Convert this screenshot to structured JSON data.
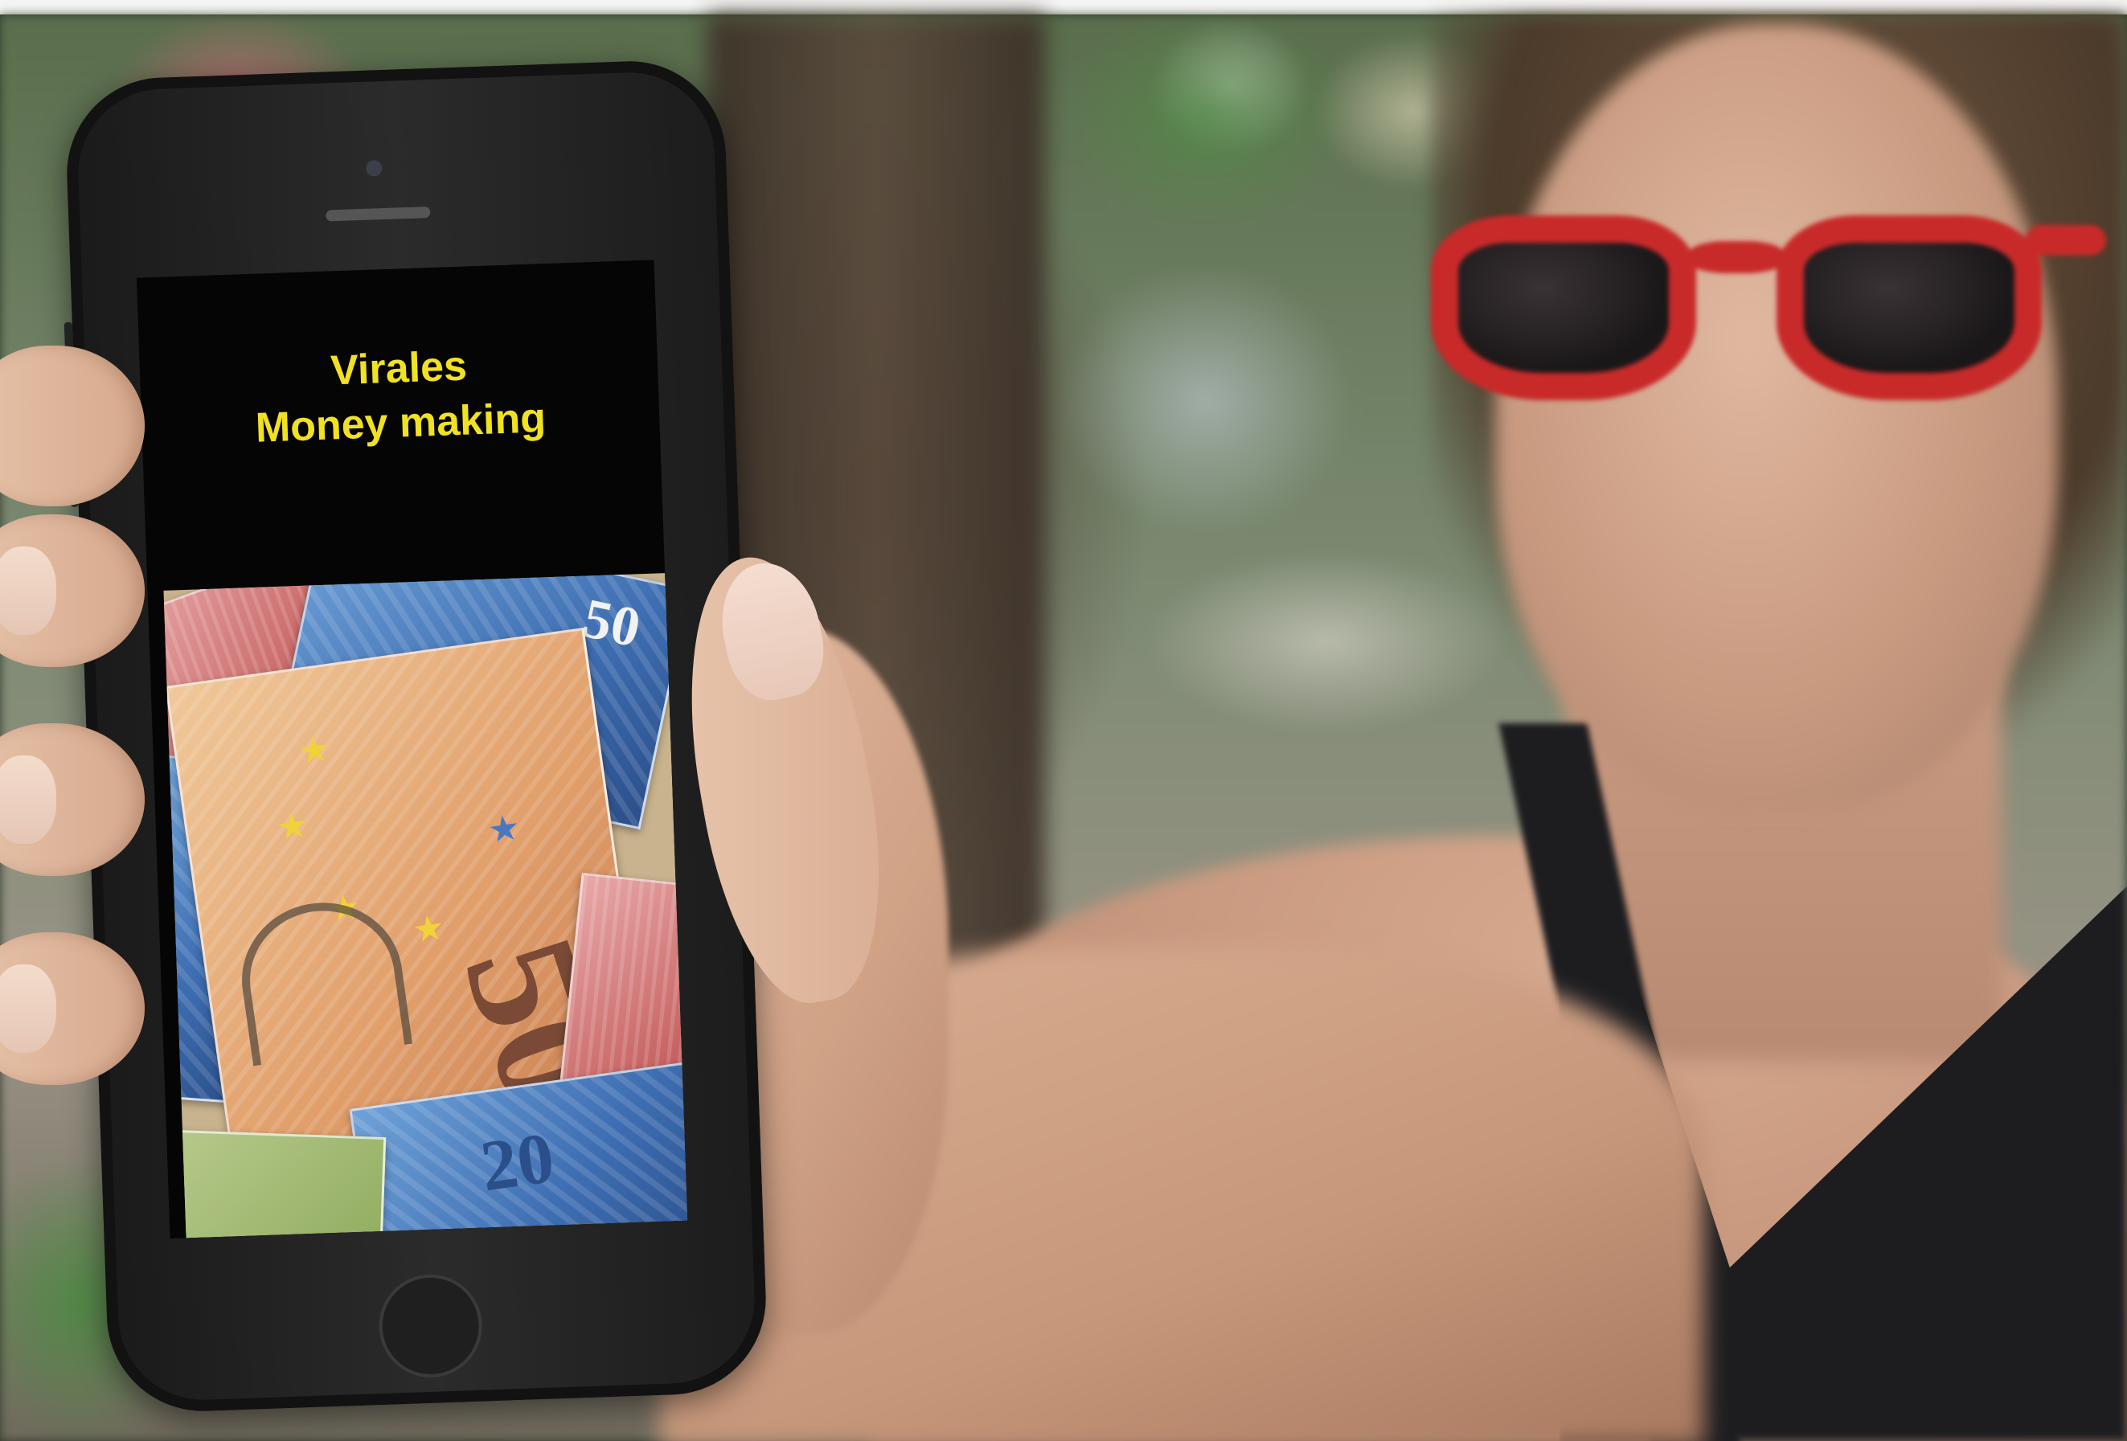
{
  "phone_screen": {
    "title_line_1": "Virales",
    "title_line_2": "Money making",
    "title_color": "#f1e123",
    "banknote_values": [
      "50",
      "50",
      "20"
    ]
  },
  "accent_colors": {
    "sunglasses": "#c82a2a",
    "screen_background": "#050505",
    "top_strip": "#f4f4f4"
  }
}
